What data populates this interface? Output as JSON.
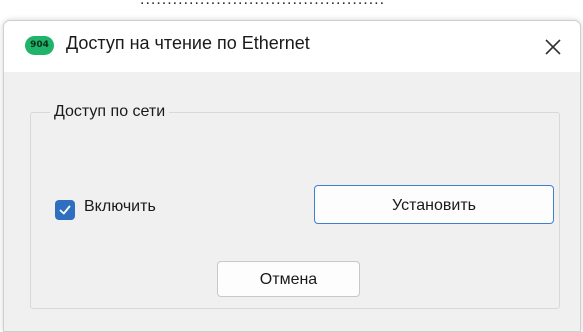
{
  "window": {
    "title": "Доступ на чтение по Ethernet",
    "app_icon_text": "904",
    "app_icon_color": "#1fb46a"
  },
  "background": {
    "partial_text": "............................................."
  },
  "group": {
    "label": "Доступ по сети"
  },
  "checkbox": {
    "label": "Включить",
    "checked": true,
    "color": "#2f6fbf"
  },
  "buttons": {
    "set_label": "Установить",
    "cancel_label": "Отмена",
    "focus_color": "#3f7fd2"
  },
  "icons": {
    "close": "close-icon",
    "check": "checkmark-icon"
  }
}
